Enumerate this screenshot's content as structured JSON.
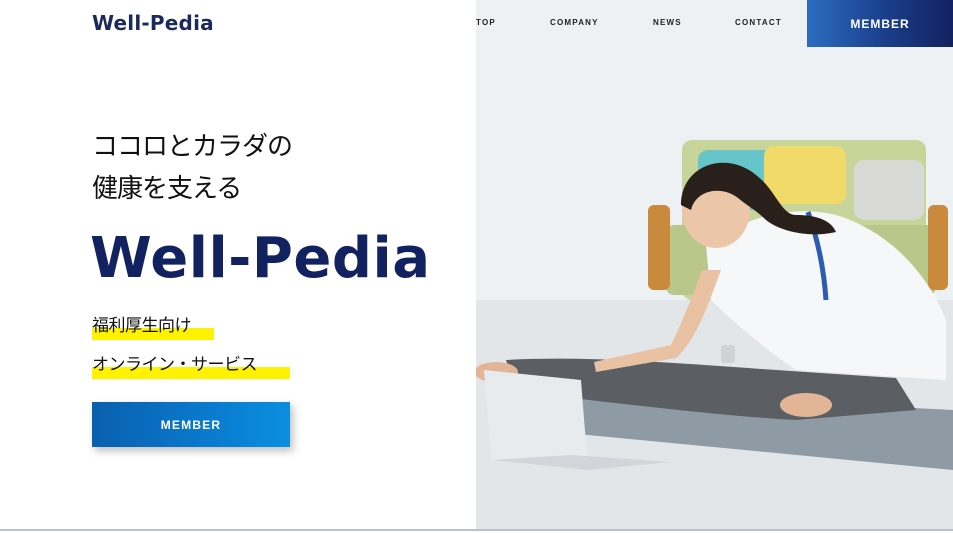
{
  "header": {
    "logo": "Well-Pedia",
    "nav": [
      "TOP",
      "COMPANY",
      "NEWS",
      "CONTACT"
    ],
    "member_button": "MEMBER"
  },
  "hero": {
    "tagline_line1": "ココロとカラダの",
    "tagline_line2": "健康を支える",
    "brand": "Well-Pedia",
    "sub1": "福利厚生向け",
    "sub2": "オンライン・サービス",
    "member_button": "MEMBER",
    "image_alt": "woman stretching in front of laptop"
  },
  "colors": {
    "navy": "#12215f",
    "highlight": "#fff200",
    "button_blue": "#0a78cc"
  }
}
